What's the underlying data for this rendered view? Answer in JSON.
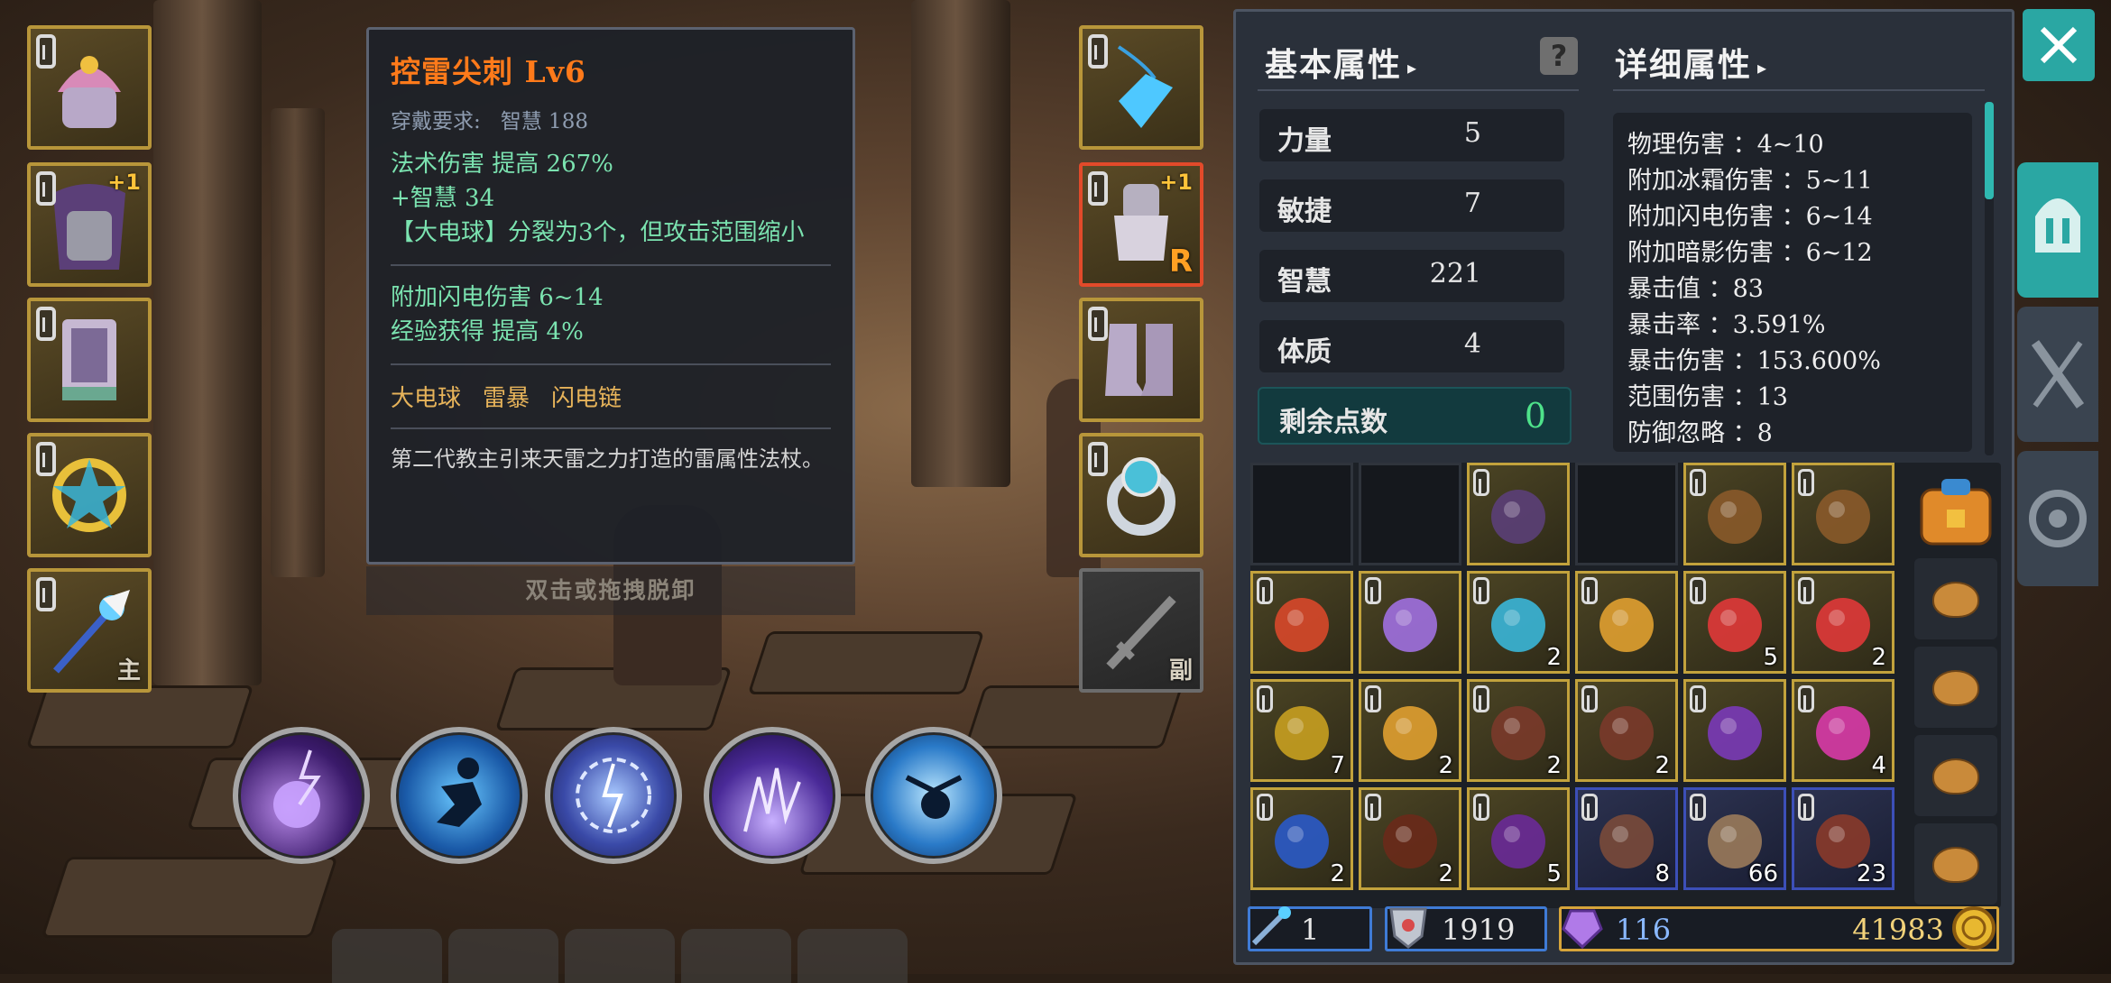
{
  "tooltip": {
    "name": "控雷尖刺  Lv6",
    "req_label": "穿戴要求:",
    "req_value": "智慧 188",
    "lines_a": [
      "法术伤害 提高 267%",
      "+智慧 34",
      "【大电球】分裂为3个，但攻击范围缩小"
    ],
    "lines_b": [
      "附加闪电伤害 6~14",
      "经验获得 提高 4%"
    ],
    "skills": [
      "大电球",
      "雷暴",
      "闪电链"
    ],
    "description": "第二代教主引来天雷之力打造的雷属性法杖。",
    "unequip_hint": "双击或拖拽脱卸"
  },
  "left_slots": [
    {
      "icon": "hat-icon",
      "plus": "",
      "tag": ""
    },
    {
      "icon": "cloak-icon",
      "plus": "+1",
      "tag": ""
    },
    {
      "icon": "armor-icon",
      "plus": "",
      "tag": ""
    },
    {
      "icon": "amulet-icon",
      "plus": "",
      "tag": ""
    },
    {
      "icon": "staff-icon",
      "plus": "",
      "tag": "主"
    }
  ],
  "right_slots": [
    {
      "icon": "crystal-necklace-icon",
      "plus": "",
      "tag": ""
    },
    {
      "icon": "gauntlet-icon",
      "plus": "+1",
      "tag": "R"
    },
    {
      "icon": "boots-icon",
      "plus": "",
      "tag": ""
    },
    {
      "icon": "ring-icon",
      "plus": "",
      "tag": ""
    },
    {
      "icon": "sword-icon",
      "plus": "",
      "tag": "副"
    }
  ],
  "skills": [
    "lightning-orb-icon",
    "dash-icon",
    "thunder-storm-icon",
    "chain-lightning-icon",
    "teleport-icon"
  ],
  "panel": {
    "basic_title": "基本属性",
    "detail_title": "详细属性",
    "help": "?",
    "stats": [
      {
        "label": "力量",
        "value": "5"
      },
      {
        "label": "敏捷",
        "value": "7"
      },
      {
        "label": "智慧",
        "value": "221"
      },
      {
        "label": "体质",
        "value": "4"
      }
    ],
    "free_points_label": "剩余点数",
    "free_points_value": "0",
    "details": [
      "物理伤害 ：4~10",
      "附加冰霜伤害 ：5~11",
      "附加闪电伤害 ：6~14",
      "附加暗影伤害 ：6~12",
      "暴击值 ：83",
      "暴击率 ：3.591%",
      "暴击伤害 ：153.600%",
      "范围伤害 ：13",
      "防御忽略 ：8"
    ]
  },
  "inventory": [
    [
      {
        "t": "empty"
      },
      {
        "t": "empty"
      },
      {
        "i": "cloak-icon"
      },
      {
        "t": "empty"
      },
      {
        "i": "staff-icon"
      },
      {
        "i": "staff-icon"
      }
    ],
    [
      {
        "i": "heart-amulet-icon"
      },
      {
        "i": "purple-gem-icon"
      },
      {
        "i": "rune-map-icon",
        "c": "2"
      },
      {
        "i": "scroll-icon"
      },
      {
        "i": "health-potion-icon",
        "c": "5"
      },
      {
        "i": "health-potion-icon",
        "c": "2"
      }
    ],
    [
      {
        "i": "swirl-icon",
        "c": "7"
      },
      {
        "i": "scroll-icon",
        "c": "2"
      },
      {
        "i": "claw-icon",
        "c": "2"
      },
      {
        "i": "claw-icon",
        "c": "2"
      },
      {
        "i": "dark-orb-icon"
      },
      {
        "i": "demon-face-icon",
        "c": "4"
      }
    ],
    [
      {
        "i": "blue-ring-icon",
        "c": "2"
      },
      {
        "i": "spikes-icon",
        "c": "2"
      },
      {
        "i": "cloth-icon",
        "c": "5"
      },
      {
        "i": "horn-icon",
        "c": "8"
      },
      {
        "i": "rock-shard-icon",
        "c": "66"
      },
      {
        "i": "fang-icon",
        "c": "23"
      }
    ]
  ],
  "currency": {
    "wand_count": "1",
    "shield_count": "1919",
    "gem_count": "116",
    "gold_count": "41983"
  },
  "side_tabs": [
    "helmet-icon",
    "weapons-icon",
    "settings-icon"
  ],
  "colors": {
    "accent": "#2aa7a3",
    "item_name": "#ff7a1a",
    "bonus": "#7be3b0",
    "gold_border": "#c2a23c"
  }
}
